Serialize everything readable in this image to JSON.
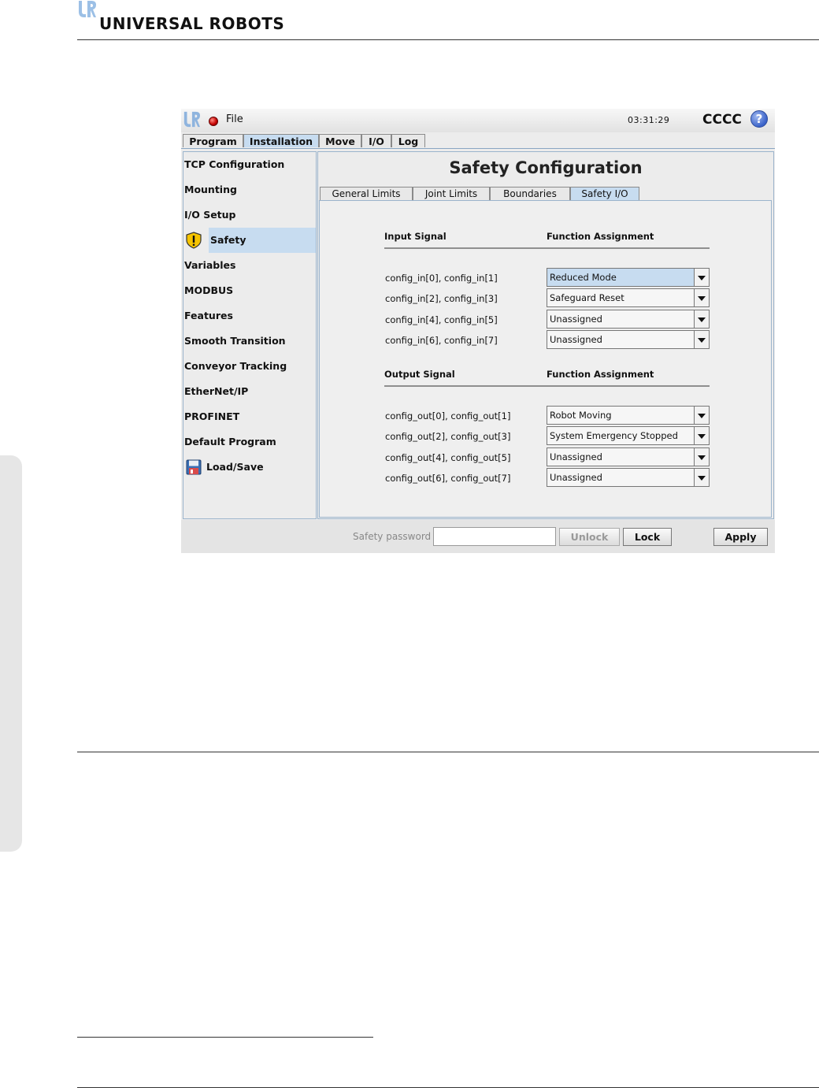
{
  "document": {
    "brand": "UNIVERSAL ROBOTS"
  },
  "app": {
    "file_menu": "File",
    "clock": "03:31:29",
    "robot_name": "CCCC",
    "help": "?",
    "main_tabs": [
      {
        "label": "Program",
        "active": false
      },
      {
        "label": "Installation",
        "active": true
      },
      {
        "label": "Move",
        "active": false
      },
      {
        "label": "I/O",
        "active": false
      },
      {
        "label": "Log",
        "active": false
      }
    ],
    "sidebar": {
      "selected": "Safety",
      "items": [
        {
          "label": "TCP Configuration"
        },
        {
          "label": "Mounting"
        },
        {
          "label": "I/O Setup"
        },
        {
          "label": "Safety",
          "icon": "warning-shield-icon"
        },
        {
          "label": "Variables"
        },
        {
          "label": "MODBUS"
        },
        {
          "label": "Features"
        },
        {
          "label": "Smooth Transition"
        },
        {
          "label": "Conveyor Tracking"
        },
        {
          "label": "EtherNet/IP"
        },
        {
          "label": "PROFINET"
        },
        {
          "label": "Default Program"
        },
        {
          "label": "Load/Save",
          "icon": "floppy-disk-icon"
        }
      ]
    },
    "content": {
      "title": "Safety Configuration",
      "sub_tabs": [
        {
          "label": "General Limits",
          "active": false
        },
        {
          "label": "Joint Limits",
          "active": false
        },
        {
          "label": "Boundaries",
          "active": false
        },
        {
          "label": "Safety I/O",
          "active": true
        }
      ],
      "input_section": {
        "col_signal": "Input Signal",
        "col_function": "Function Assignment",
        "rows": [
          {
            "signal": "config_in[0], config_in[1]",
            "function": "Reduced Mode"
          },
          {
            "signal": "config_in[2], config_in[3]",
            "function": "Safeguard Reset"
          },
          {
            "signal": "config_in[4], config_in[5]",
            "function": "Unassigned"
          },
          {
            "signal": "config_in[6], config_in[7]",
            "function": "Unassigned"
          }
        ]
      },
      "output_section": {
        "col_signal": "Output Signal",
        "col_function": "Function Assignment",
        "rows": [
          {
            "signal": "config_out[0], config_out[1]",
            "function": "Robot Moving"
          },
          {
            "signal": "config_out[2], config_out[3]",
            "function": "System Emergency Stopped"
          },
          {
            "signal": "config_out[4], config_out[5]",
            "function": "Unassigned"
          },
          {
            "signal": "config_out[6], config_out[7]",
            "function": "Unassigned"
          }
        ]
      }
    },
    "bottom_bar": {
      "password_label": "Safety password",
      "password_value": "",
      "unlock": "Unlock",
      "lock": "Lock",
      "apply": "Apply"
    }
  },
  "colors": {
    "selection": "#c7dcf0",
    "frame_border": "#9bb4cc",
    "led": "#c40000",
    "help": "#3b63c9"
  }
}
